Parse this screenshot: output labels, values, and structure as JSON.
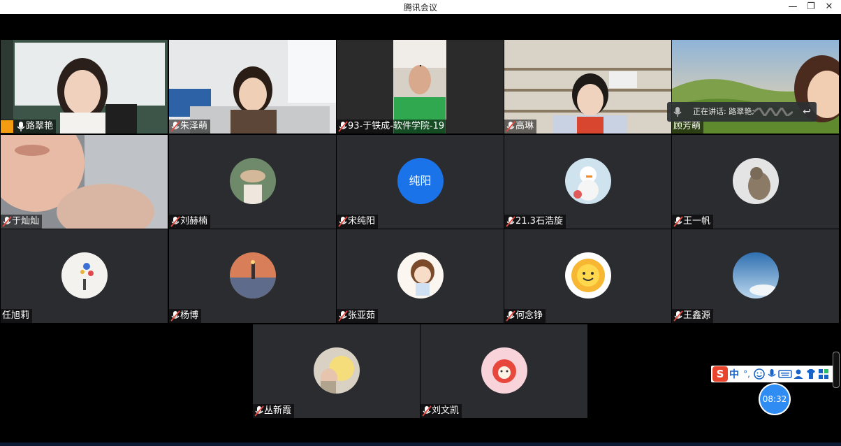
{
  "window": {
    "title": "腾讯会议",
    "buttons": {
      "minimize": "—",
      "restore": "❐",
      "close": "✕"
    }
  },
  "speaking": {
    "label": "正在讲话: 路翠艳;",
    "back_icon": "↩"
  },
  "participants": [
    {
      "name": "路翠艳",
      "host": true
    },
    {
      "name": "朱泽萌"
    },
    {
      "name": "93-于铁成-软件学院-19"
    },
    {
      "name": "高琳"
    },
    {
      "name": "顾芳萌"
    },
    {
      "name": "于灿灿"
    },
    {
      "name": "刘赫楠"
    },
    {
      "name": "宋纯阳",
      "avatar_text": "纯阳"
    },
    {
      "name": "21.3石浩旋"
    },
    {
      "name": "王一帆"
    },
    {
      "name": "任旭莉"
    },
    {
      "name": "杨博"
    },
    {
      "name": "张亚茹"
    },
    {
      "name": "何念铮"
    },
    {
      "name": "王鑫源"
    },
    {
      "name": "丛新霞"
    },
    {
      "name": "刘文凯"
    }
  ],
  "ime": {
    "logo": "S",
    "mode": "中",
    "punct": "°,"
  },
  "timer": {
    "time": "08:32"
  },
  "colors": {
    "active_border": "#2bbf6b",
    "avatar_blue": "#1a73e8",
    "host_badge": "#f39c12"
  }
}
